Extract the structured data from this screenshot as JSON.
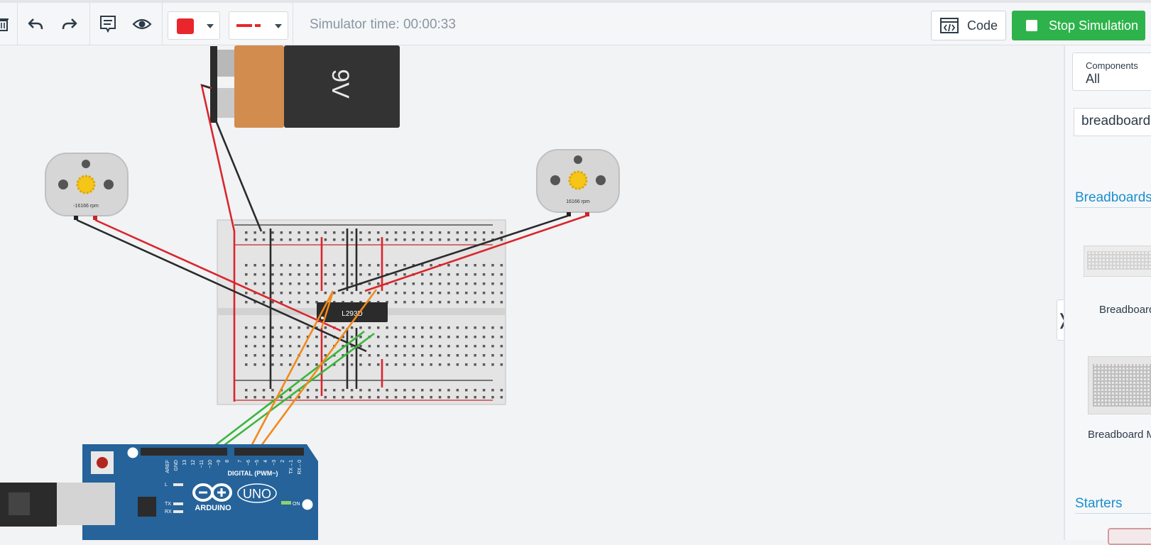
{
  "toolbar": {
    "simulator_time": "Simulator time: 00:00:33",
    "code_label": "Code",
    "stop_label": "Stop Simulation",
    "wire_color": "#e8262c"
  },
  "panel": {
    "components_label": "Components",
    "components_value": "All",
    "search_value": "breadboard",
    "sections": [
      {
        "title": "Breadboards",
        "items": [
          "Breadboard",
          "Breadboard M"
        ]
      },
      {
        "title": "Starters"
      }
    ]
  },
  "circuit": {
    "battery_label": "9V",
    "motor_left_rpm": "-16166 rpm",
    "motor_right_rpm": "16166 rpm",
    "chip_label": "L293D",
    "arduino_brand": "ARDUINO",
    "arduino_model": "UNO",
    "arduino_digital": "DIGITAL (PWM~)",
    "arduino_on": "ON",
    "pin_labels": [
      "AREF",
      "GND",
      "13",
      "12",
      "~11",
      "~10",
      "~9",
      "8",
      "7",
      "~6",
      "~5",
      "4",
      "~3",
      "2",
      "TX→1",
      "RX←0"
    ],
    "led_labels": [
      "L",
      "TX",
      "RX"
    ]
  },
  "colors": {
    "red_wire": "#e8262c",
    "black_wire": "#2b2b2b",
    "orange_wire": "#f08a1c",
    "green_wire": "#3cb63c",
    "arduino_blue": "#25639a",
    "accent_green": "#2eb34c",
    "link_blue": "#1a8fd1"
  }
}
